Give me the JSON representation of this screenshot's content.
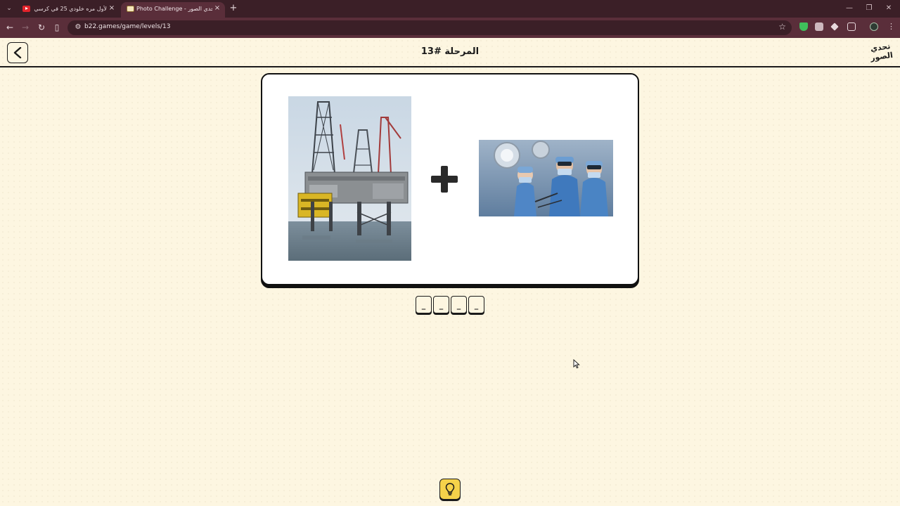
{
  "browser": {
    "tabs": [
      {
        "title": "لأول مره خلودي 25 في كرسي الا",
        "active": false,
        "favicon": "youtube-icon"
      },
      {
        "title": "Photo Challenge - تحدي الصور",
        "active": true,
        "favicon": "game-favicon"
      }
    ],
    "url": "b22.games/game/levels/13",
    "icons": {
      "tab_list": "chevron-down-icon",
      "close": "×",
      "new_tab": "+",
      "minimize": "—",
      "maximize": "❐",
      "window_close": "✕",
      "back": "←",
      "forward": "→",
      "reload": "↻",
      "side_panel": "▯",
      "site_info": "⚙",
      "bookmark": "☆",
      "menu": "⋮"
    }
  },
  "game": {
    "level_title": "المرحلة #13",
    "logo_text": "تحدي الصور",
    "clue_images": [
      {
        "name": "oil-rig-image",
        "subject": "offshore oil drilling platform"
      },
      {
        "name": "surgeons-image",
        "subject": "surgeons in operating room"
      }
    ],
    "operator": "+",
    "answer_slots": [
      "_",
      "_",
      "_",
      "_"
    ],
    "hint_icon": "lightbulb-icon"
  },
  "colors": {
    "page_bg": "#fdf6e1",
    "ink": "#1b1b1b",
    "hint_yellow": "#f5d24a",
    "tab_bar": "#3b1f27",
    "toolbar": "#5a2e3a"
  }
}
